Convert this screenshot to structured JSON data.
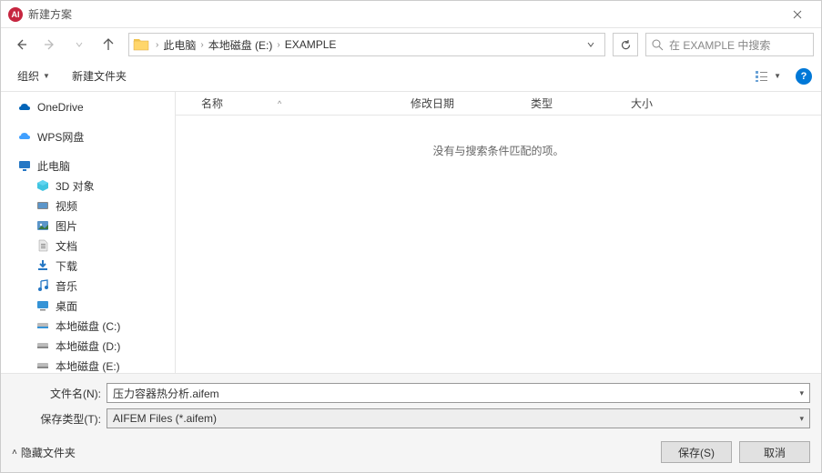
{
  "window": {
    "title": "新建方案"
  },
  "nav": {
    "breadcrumbs": [
      {
        "label": "此电脑"
      },
      {
        "label": "本地磁盘 (E:)"
      },
      {
        "label": "EXAMPLE"
      }
    ],
    "search_placeholder": "在 EXAMPLE 中搜索"
  },
  "toolbar": {
    "organize": "组织",
    "new_folder": "新建文件夹"
  },
  "sidebar": {
    "onedrive": "OneDrive",
    "wps": "WPS网盘",
    "this_pc": "此电脑",
    "items": [
      {
        "label": "3D 对象"
      },
      {
        "label": "视频"
      },
      {
        "label": "图片"
      },
      {
        "label": "文档"
      },
      {
        "label": "下载"
      },
      {
        "label": "音乐"
      },
      {
        "label": "桌面"
      },
      {
        "label": "本地磁盘 (C:)"
      },
      {
        "label": "本地磁盘 (D:)"
      },
      {
        "label": "本地磁盘 (E:)"
      }
    ]
  },
  "columns": {
    "name": "名称",
    "date": "修改日期",
    "type": "类型",
    "size": "大小"
  },
  "content": {
    "empty_message": "没有与搜索条件匹配的项。"
  },
  "form": {
    "filename_label": "文件名(N):",
    "filename_value": "压力容器热分析.aifem",
    "filetype_label": "保存类型(T):",
    "filetype_value": "AIFEM Files (*.aifem)"
  },
  "footer": {
    "hide_folders": "隐藏文件夹",
    "save": "保存(S)",
    "cancel": "取消"
  }
}
